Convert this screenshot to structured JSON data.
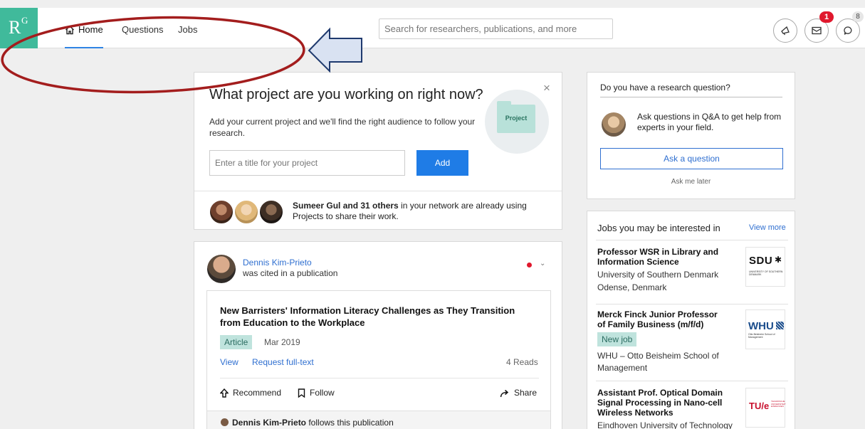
{
  "nav": {
    "logo_r": "R",
    "logo_g": "G",
    "home": "Home",
    "questions": "Questions",
    "jobs": "Jobs",
    "search_placeholder": "Search for researchers, publications, and more",
    "messages_count": "1",
    "notifications_count": "8"
  },
  "project_card": {
    "title": "What project are you working on right now?",
    "description": "Add your current project and we'll find the right audience to follow your research.",
    "input_placeholder": "Enter a title for your project",
    "add_label": "Add",
    "close": "×",
    "folder_label": "Project",
    "footer_bold": "Sumeer Gul and 31 others",
    "footer_rest": " in your network are already using Projects to share their work."
  },
  "feed": {
    "author": "Dennis Kim-Prieto",
    "action": "was cited in a publication",
    "publication": {
      "title": "New Barristers' Information Literacy Challenges as They Transition from Education to the Workplace",
      "type": "Article",
      "date": "Mar 2019",
      "view": "View",
      "request": "Request full-text",
      "reads": "4 Reads",
      "recommend": "Recommend",
      "follow": "Follow",
      "share": "Share",
      "follower": "Dennis Kim-Prieto",
      "follower_text": " follows this publication"
    }
  },
  "question_card": {
    "heading": "Do you have a research question?",
    "text": "Ask questions in Q&A to get help from experts in your field.",
    "button": "Ask a question",
    "later": "Ask me later"
  },
  "jobs_card": {
    "heading": "Jobs you may be interested in",
    "view_more": "View more",
    "jobs": [
      {
        "title": "Professor WSR in Library and Information Science",
        "employer": "University of Southern Denmark",
        "location": "Odense, Denmark",
        "logo_text": "SDU",
        "logo_sub": "UNIVERSITY OF SOUTHERN DENMARK"
      },
      {
        "title": "Merck Finck Junior Professor of Family Business (m/f/d)",
        "badge": "New job",
        "employer": "WHU – Otto Beisheim School of Management",
        "logo_text": "WHU",
        "logo_sub": "Otto Beisheim School of Management"
      },
      {
        "title": "Assistant Prof. Optical Domain Signal Processing in Nano-cell Wireless Networks",
        "employer": "Eindhoven University of Technology",
        "logo_text": "TU/e",
        "logo_sub": "TECHNISCHE UNIVERSITEIT EINDHOVEN"
      }
    ]
  },
  "colors": {
    "brand": "#40ba9b",
    "link": "#2f6fd0",
    "primary_button": "#1f7ce6",
    "badge": "#e0182d",
    "annotation": "#a31d1d"
  }
}
